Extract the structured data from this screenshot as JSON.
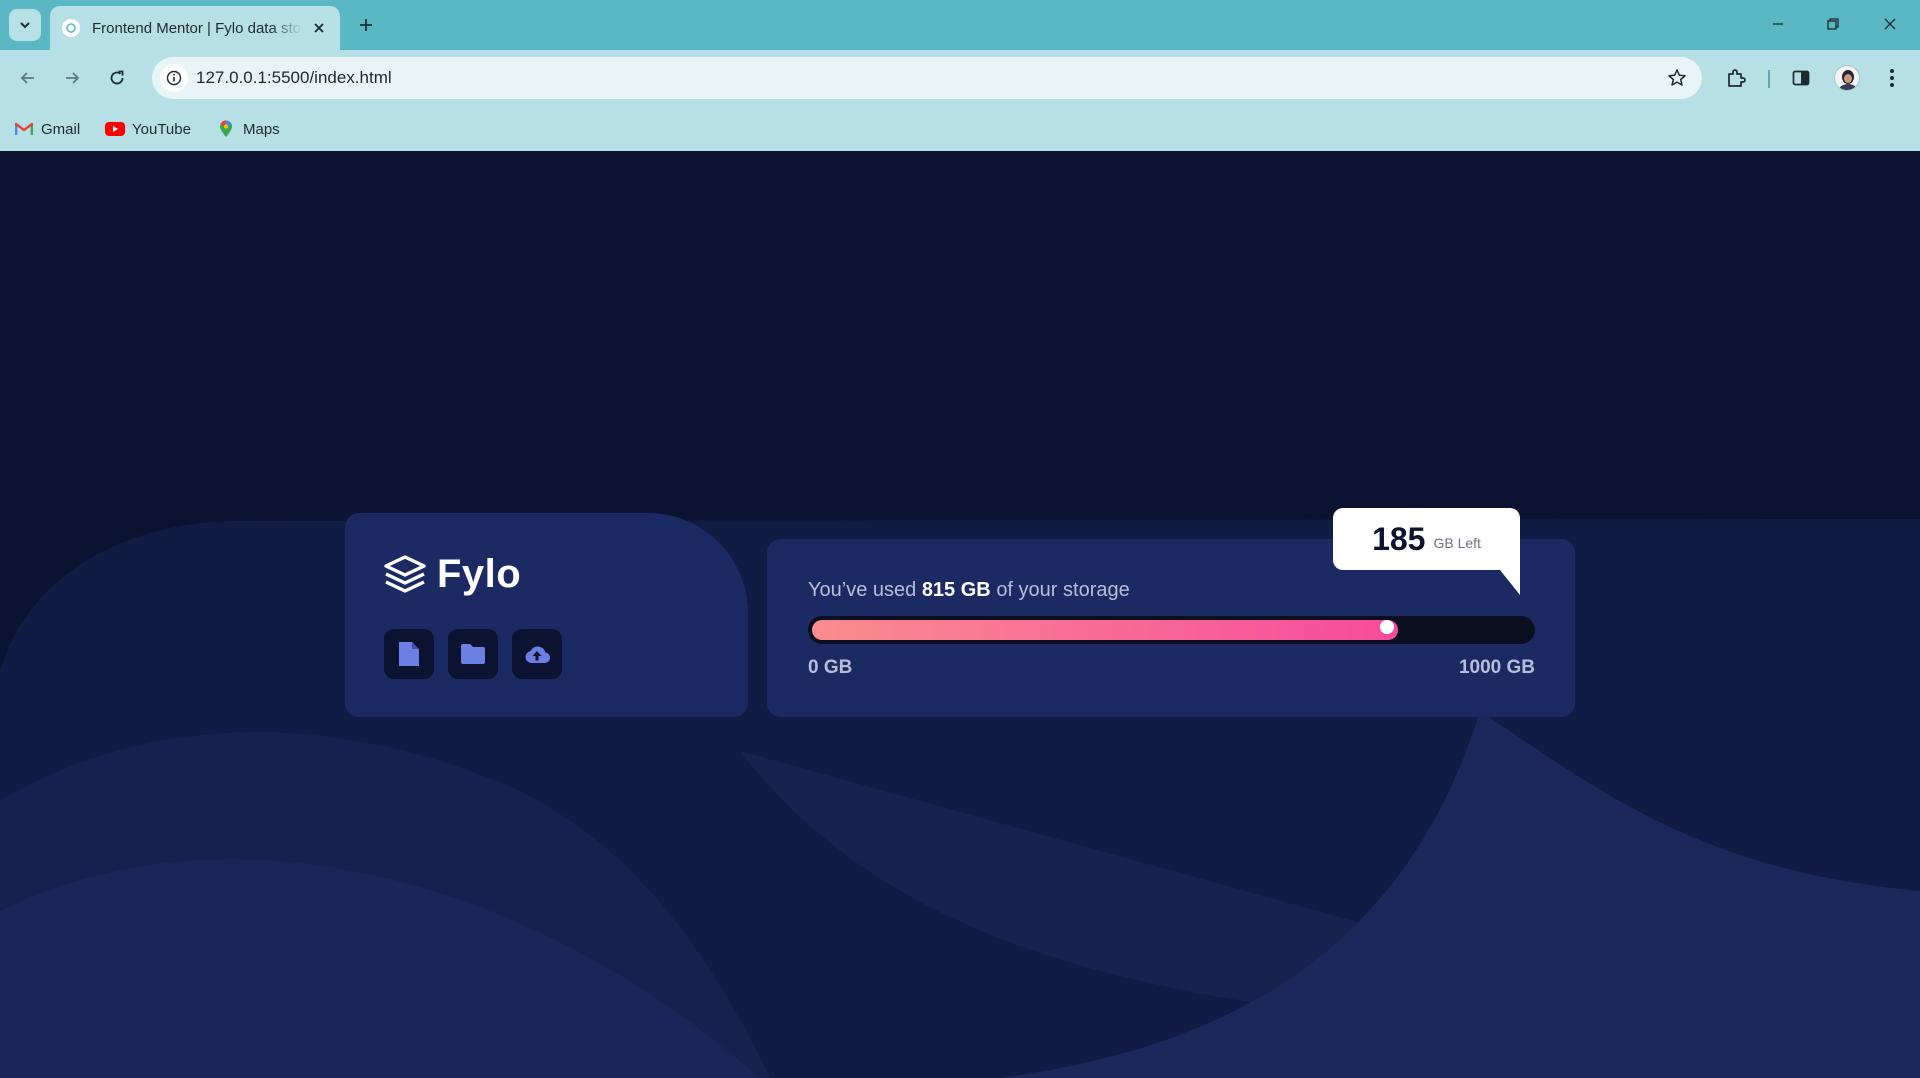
{
  "browser": {
    "tab": {
      "title": "Frontend Mentor | Fylo data storage component"
    },
    "url": "127.0.0.1:5500/index.html",
    "bookmarks": [
      {
        "label": "Gmail",
        "icon": "gmail-icon"
      },
      {
        "label": "YouTube",
        "icon": "youtube-icon"
      },
      {
        "label": "Maps",
        "icon": "maps-icon"
      }
    ]
  },
  "app": {
    "logo_text": "Fylo",
    "icon_buttons": [
      {
        "name": "document-icon"
      },
      {
        "name": "folder-icon"
      },
      {
        "name": "upload-icon"
      }
    ],
    "usage": {
      "prefix": "You’ve used",
      "used_value": "815 GB",
      "suffix": "of your storage",
      "fraction": 0.815
    },
    "scale_min": "0 GB",
    "scale_max": "1000 GB",
    "remaining_number": "185",
    "remaining_unit": "GB Left"
  },
  "colors": {
    "page_bg": "#0c1330",
    "card_bg": "#1c2a63",
    "gradient_start": "#fa8c8e",
    "gradient_end": "#f64b9d",
    "tab_bar": "#5ab8c4",
    "toolbar": "#b6e0e5"
  }
}
